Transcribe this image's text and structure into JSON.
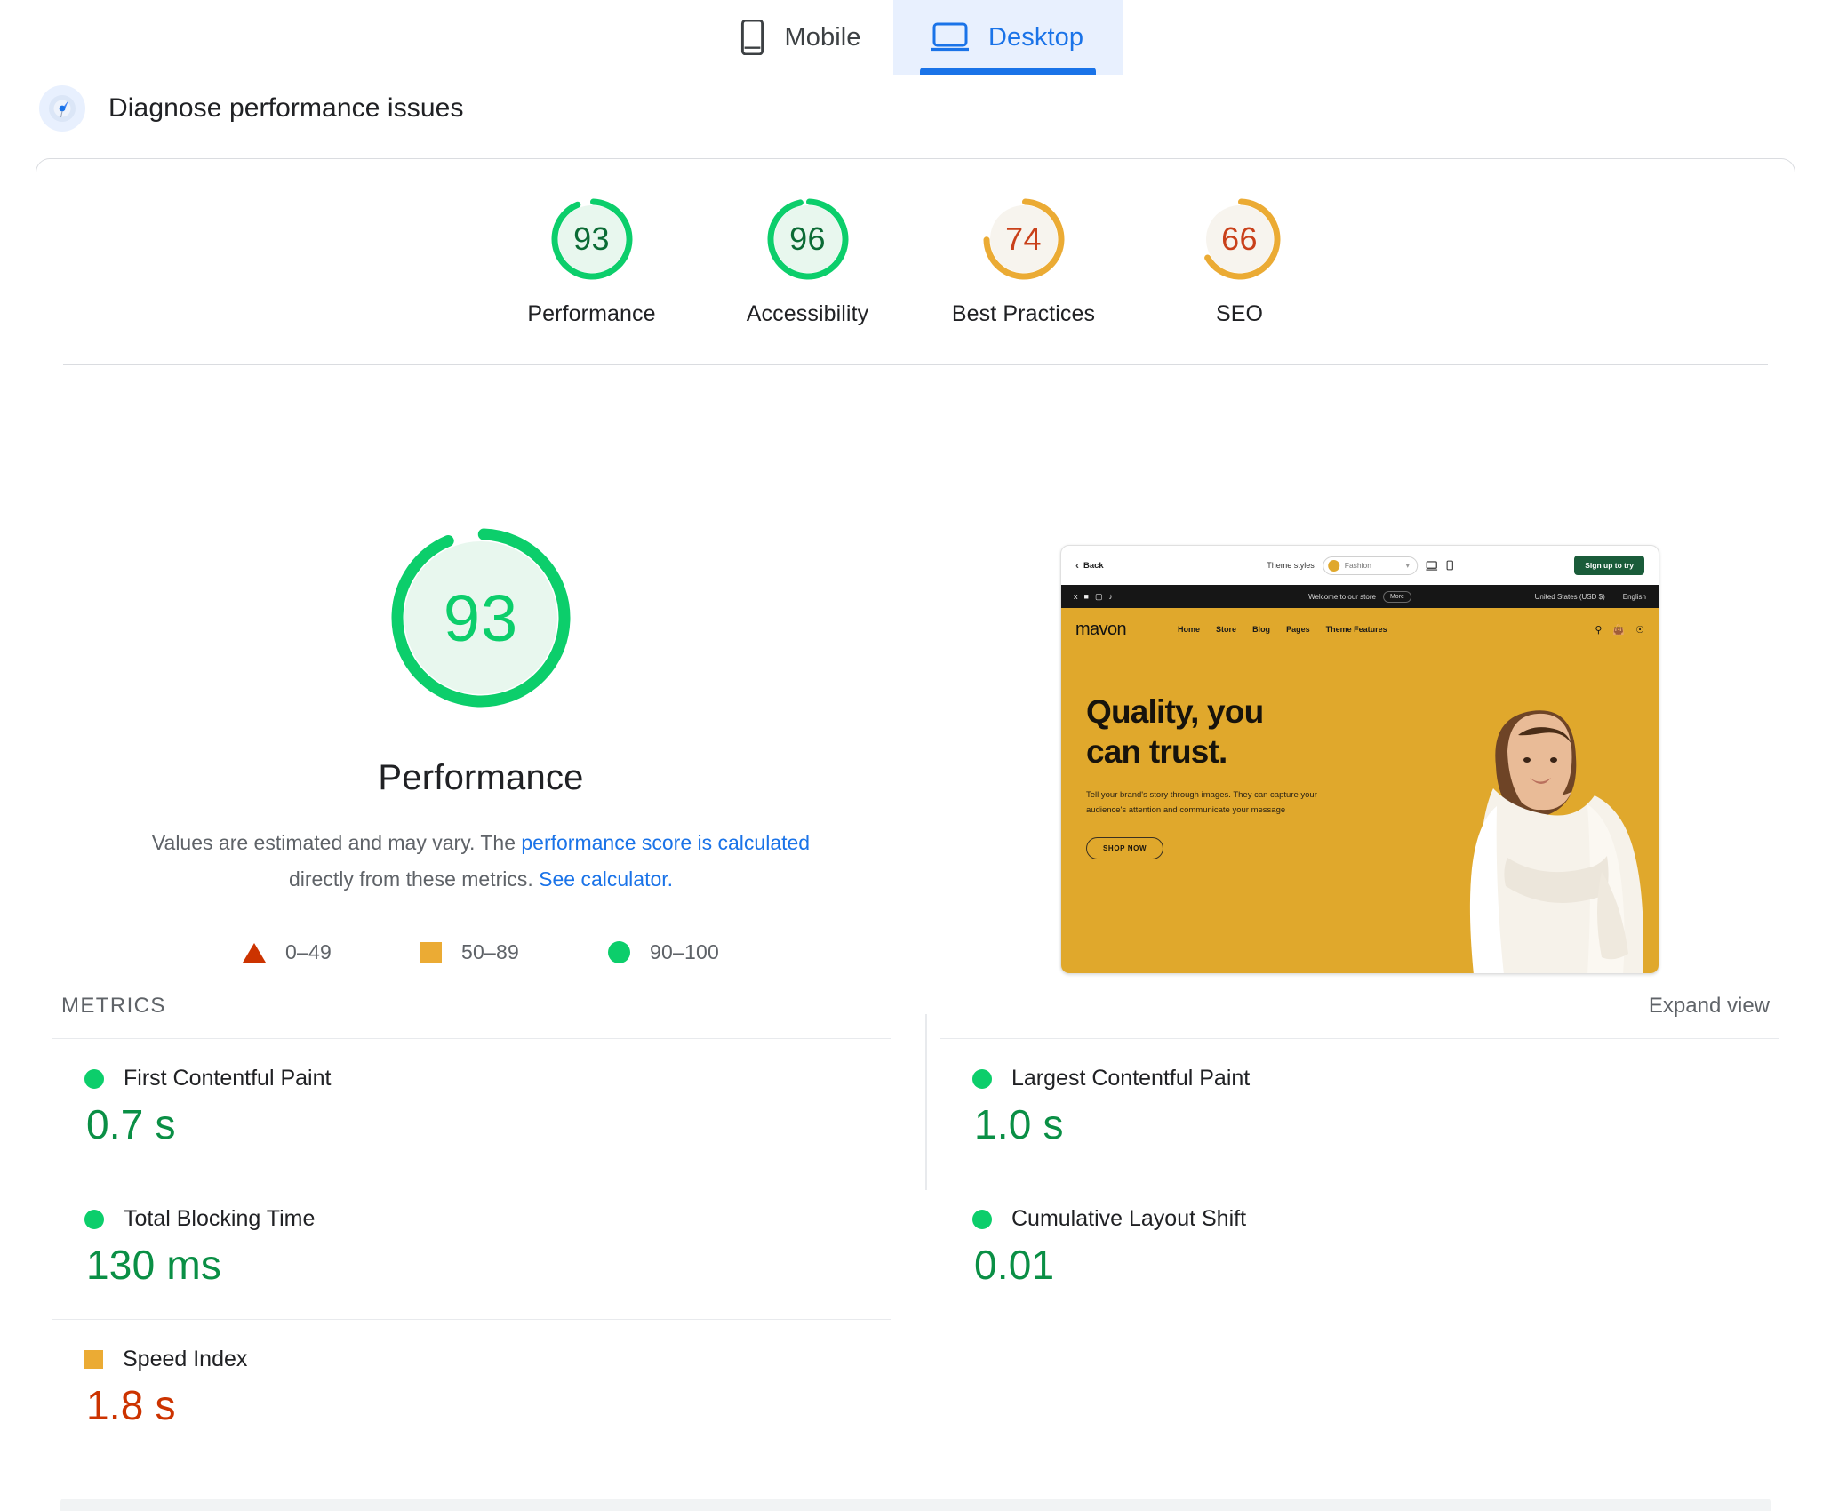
{
  "tabs": [
    {
      "id": "mobile",
      "label": "Mobile",
      "icon": "mobile-phone-icon",
      "active": false
    },
    {
      "id": "desktop",
      "label": "Desktop",
      "icon": "desktop-monitor-icon",
      "active": true
    }
  ],
  "section": {
    "title": "Diagnose performance issues",
    "icon": "lighthouse-icon"
  },
  "category_scores": [
    {
      "key": "performance",
      "label": "Performance",
      "score": 93,
      "color": "#0cce6b",
      "num_color": "#0b6b35",
      "track": "#e8f7ee"
    },
    {
      "key": "accessibility",
      "label": "Accessibility",
      "score": 96,
      "color": "#0cce6b",
      "num_color": "#0b6b35",
      "track": "#e8f7ee"
    },
    {
      "key": "best-practices",
      "label": "Best Practices",
      "score": 74,
      "color": "#ebab34",
      "num_color": "#c9401a",
      "track": "#f7f4ee"
    },
    {
      "key": "seo",
      "label": "SEO",
      "score": 66,
      "color": "#ebab34",
      "num_color": "#c9401a",
      "track": "#f7f4ee"
    }
  ],
  "detail": {
    "score": 93,
    "category": "Performance",
    "disclaimer_pre": "Values are estimated and may vary. The ",
    "disclaimer_link1": "performance score is calculated",
    "disclaimer_mid": " directly from these metrics. ",
    "disclaimer_link2": "See calculator.",
    "gauge_color": "#0cce6b",
    "gauge_track": "#e8f7ee"
  },
  "legend": [
    {
      "shape": "triangle",
      "label": "0–49",
      "color": "#cc3300"
    },
    {
      "shape": "square",
      "label": "50–89",
      "color": "#ebab34"
    },
    {
      "shape": "circle",
      "label": "90–100",
      "color": "#0cce6b"
    }
  ],
  "metrics_section": {
    "title": "METRICS",
    "expand_label": "Expand view"
  },
  "metrics": [
    {
      "name": "First Contentful Paint",
      "value": "0.7 s",
      "shape": "circle",
      "marker_color": "#0cce6b",
      "value_color": "#0a8f45"
    },
    {
      "name": "Largest Contentful Paint",
      "value": "1.0 s",
      "shape": "circle",
      "marker_color": "#0cce6b",
      "value_color": "#0a8f45"
    },
    {
      "name": "Total Blocking Time",
      "value": "130 ms",
      "shape": "circle",
      "marker_color": "#0cce6b",
      "value_color": "#0a8f45"
    },
    {
      "name": "Cumulative Layout Shift",
      "value": "0.01",
      "shape": "circle",
      "marker_color": "#0cce6b",
      "value_color": "#0a8f45"
    },
    {
      "name": "Speed Index",
      "value": "1.8 s",
      "shape": "square",
      "marker_color": "#ebab34",
      "value_color": "#cc3300"
    }
  ],
  "screenshot": {
    "back_label": "Back",
    "theme_styles_label": "Theme styles",
    "theme_selected": "Fashion",
    "signup_label": "Sign up to try",
    "announcement": "Welcome to our store",
    "announcement_more": "More",
    "currency": "United States (USD $)",
    "language": "English",
    "logo_bold": "mav",
    "logo_light": "on",
    "nav": [
      "Home",
      "Store",
      "Blog",
      "Pages",
      "Theme Features"
    ],
    "hero_title_line1": "Quality, you",
    "hero_title_line2": "can trust.",
    "hero_paragraph": "Tell your brand's story through images. They can capture your audience's attention and communicate your message",
    "hero_button": "SHOP NOW",
    "cart_count": "0",
    "brand_color": "#e0a82c"
  }
}
